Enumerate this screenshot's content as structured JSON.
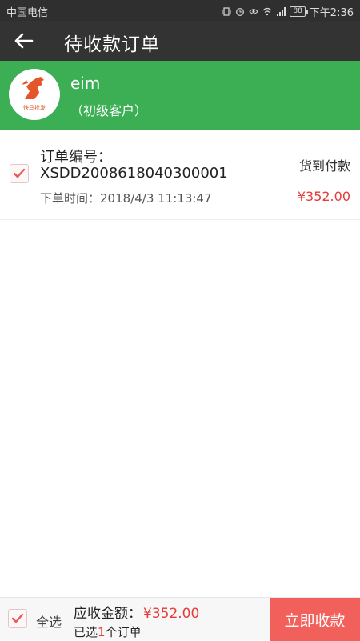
{
  "status_bar": {
    "carrier": "中国电信",
    "battery": "88",
    "time": "下午2:36",
    "icons": [
      "vibrate-icon",
      "alarm-icon",
      "eye-icon",
      "wifi-icon",
      "4g-signal-icon",
      "battery-icon"
    ]
  },
  "header": {
    "back_icon": "back-arrow-icon",
    "title": "待收款订单"
  },
  "customer": {
    "logo_text": "快马批发",
    "name": "eim",
    "level": "（初级客户）",
    "colors": {
      "bar": "#3cae54",
      "logo": "#e4562a"
    }
  },
  "orders": [
    {
      "checked": true,
      "number_label": "订单编号：",
      "number": "XSDD2008618040300001",
      "payment_method": "货到付款",
      "time_label": "下单时间：",
      "time": "2018/4/3 11:13:47",
      "amount": "¥352.00"
    }
  ],
  "footer": {
    "select_all_label": "全选",
    "select_all_checked": true,
    "receivable_label": "应收金额：",
    "receivable_amount": "¥352.00",
    "selected_prefix": "已选",
    "selected_count": "1",
    "selected_suffix": "个订单",
    "collect_button": "立即收款",
    "colors": {
      "accent": "#e83a3a",
      "button": "#f2605b"
    }
  }
}
